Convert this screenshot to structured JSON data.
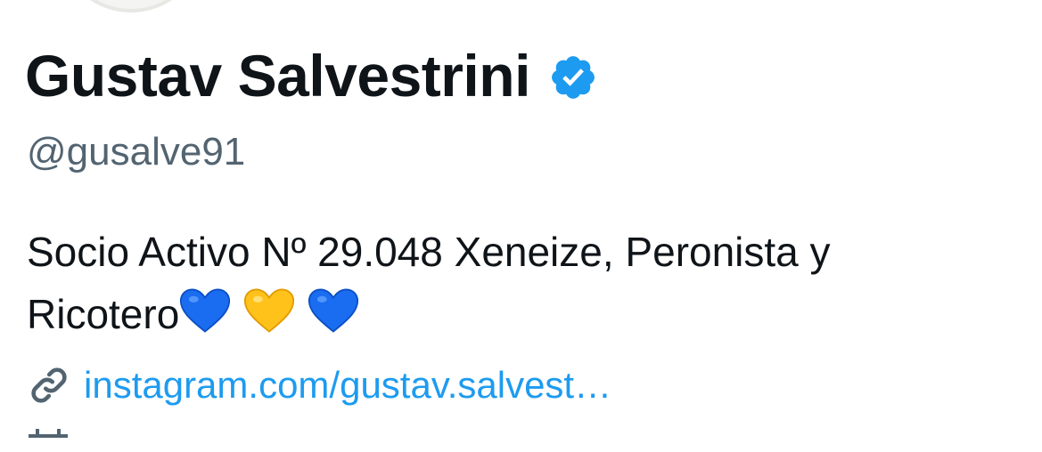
{
  "profile": {
    "display_name": "Gustav Salvestrini",
    "verified_icon": "verified-badge-icon",
    "handle": "@gusalve91",
    "bio_line1": "Socio Activo Nº 29.048 Xeneize, Peronista y",
    "bio_line2": "Ricotero",
    "bio_emojis": [
      "blue-heart",
      "yellow-heart",
      "blue-heart"
    ],
    "link_icon": "link-icon",
    "link_text": "instagram.com/gustav.salvest…",
    "calendar_icon": "calendar-icon"
  },
  "colors": {
    "text_primary": "#0f1419",
    "text_secondary": "#536471",
    "link": "#1d9bf0",
    "verified": "#1d9bf0",
    "heart_blue": "#1a6cf0",
    "heart_yellow": "#ffc21a"
  }
}
